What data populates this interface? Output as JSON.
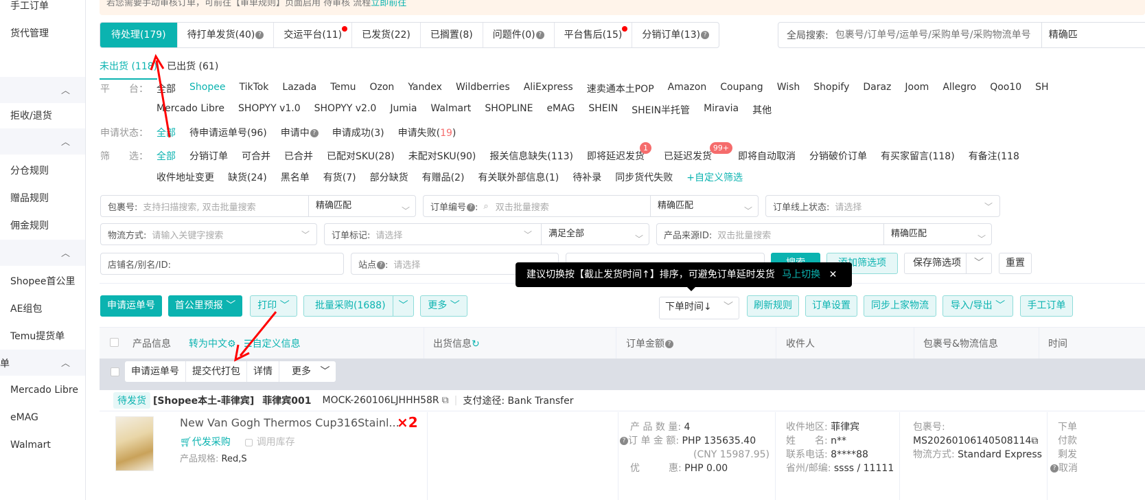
{
  "sidebar": {
    "items_top": [
      "手工订单",
      "货代管理"
    ],
    "group1_items": [
      "拒收/退货"
    ],
    "group2_items": [
      "分仓规则",
      "赠品规则",
      "佣金规则"
    ],
    "group3_items": [
      "Shopee首公里",
      "AE组包",
      "Temu提货单"
    ],
    "group4_label": "单",
    "group4_items": [
      "Mercado Libre",
      "eMAG",
      "Walmart"
    ]
  },
  "notice": {
    "text": "若您需要手动审核订单，可前往【审单规则】页面启用 待审核 流程",
    "link": "立即前往"
  },
  "tabs": [
    {
      "label": "待处理(179)"
    },
    {
      "label": "待打单发货(40)"
    },
    {
      "label": "交运平台(11)"
    },
    {
      "label": "已发货(22)"
    },
    {
      "label": "已搁置(8)"
    },
    {
      "label": "问题件(0)"
    },
    {
      "label": "平台售后(15)"
    },
    {
      "label": "分销订单(13)"
    }
  ],
  "global_search": {
    "label": "全局搜索:",
    "placeholder": "包裹号/订单号/运单号/采购单号/采购物流单号",
    "match": "精确匹"
  },
  "subtabs": [
    "未出货 (118)",
    "已出货 (61)"
  ],
  "platform": {
    "label": "平　　台：",
    "options": [
      "全部",
      "Shopee",
      "TikTok",
      "Lazada",
      "Temu",
      "Ozon",
      "Yandex",
      "Wildberries",
      "AliExpress",
      "速卖通本土POP",
      "Amazon",
      "Coupang",
      "Wish",
      "Shopify",
      "Daraz",
      "Joom",
      "Allegro",
      "Qoo10",
      "SH"
    ],
    "options2": [
      "Mercado Libre",
      "SHOPYY v1.0",
      "SHOPYY v2.0",
      "Jumia",
      "Walmart",
      "SHOPLINE",
      "eMAG",
      "SHEIN",
      "SHEIN半托管",
      "Miravia",
      "其他"
    ]
  },
  "apply_status": {
    "label": "申请状态：",
    "options": [
      "全部",
      "待申请运单号(96)",
      "申请中",
      "申请成功(3)",
      "申请失败("
    ],
    "fail_count": "19",
    "fail_close": ")"
  },
  "filter": {
    "label": "筛　　选：",
    "options": [
      "全部",
      "分销订单",
      "可合并",
      "已合并",
      "已配对SKU(28)",
      "未配对SKU(90)",
      "报关信息缺失(113)",
      "即将延迟发货",
      "已延迟发货",
      "即将自动取消",
      "分销破价订单",
      "有买家留言(118)",
      "有备注(118"
    ],
    "badge_soon": "1",
    "badge_late": "99+",
    "options2": [
      "收件地址变更",
      "缺货(24)",
      "黑名单",
      "有货(7)",
      "部分缺货",
      "有赠品(2)",
      "有关联外部信息(1)",
      "待补录",
      "同步货代失败"
    ],
    "custom": "+自定义筛选"
  },
  "form": {
    "package": {
      "label": "包裹号:",
      "placeholder": "支持扫描搜索, 双击批量搜索",
      "match": "精确匹配"
    },
    "order_no": {
      "label": "订单编号",
      "placeholder": "双击批量搜索",
      "match": "精确匹配"
    },
    "online_status": {
      "label": "订单线上状态:",
      "placeholder": "请选择"
    },
    "logistics": {
      "label": "物流方式:",
      "placeholder": "请输入关键字搜索"
    },
    "order_mark": {
      "label": "订单标记:",
      "placeholder": "请选择",
      "match": "满足全部"
    },
    "source_id": {
      "label": "产品来源ID:",
      "placeholder": "双击批量搜索",
      "match": "精确匹配"
    },
    "shop": {
      "label": "店铺名/别名/ID:"
    },
    "site": {
      "label": "站点",
      "placeholder": "请选择"
    },
    "search_btn": "搜索",
    "add_filter": "添加筛选项",
    "save_filter": "保存筛选项",
    "reset": "重置"
  },
  "tooltip": {
    "text": "建议切换按【截止发货时间↑】排序，可避免订单延时发货",
    "link": "马上切换",
    "close": "✕"
  },
  "actions": {
    "apply": "申请运单号",
    "first_mile": "首公里预报",
    "print": "打印",
    "bulk_purchase": "批量采购(1688)",
    "more": "更多",
    "sort": "下单时间↓",
    "refresh": "刷新规则",
    "settings": "订单设置",
    "sync": "同步上家物流",
    "import_export": "导入/导出",
    "manual": "手工订单"
  },
  "table": {
    "headers": {
      "product": "产品信息",
      "to_chinese": "转为中文",
      "custom_info": "自定义信息",
      "shipping": "出货信息",
      "amount": "订单金额",
      "recipient": "收件人",
      "package": "包裹号&物流信息",
      "time": "时间"
    }
  },
  "batch": [
    "申请运单号",
    "提交代打包",
    "详情",
    "更多"
  ],
  "order": {
    "status": "待发货",
    "shop": "[Shopee本土-菲律宾]",
    "shop_name": "菲律宾001",
    "order_id": "MOCK-260106LJHHH58R",
    "payment": "支付途径: Bank Transfer",
    "product_title": "New Van Gogh Thermos Cup316Stainl...",
    "qty": "×2",
    "proxy_purchase": "代发采购",
    "use_stock": "调用库存",
    "spec_label": "产品规格:",
    "spec": "Red,S",
    "amount": {
      "qty_k": "产 品 数 量:",
      "qty_v": "4",
      "total_k": "订 单 金 额:",
      "total_v": "PHP 135635.40",
      "cny": "(CNY 15987.95)",
      "disc_k": "优　　　惠:",
      "disc_v": "PHP 0.00"
    },
    "recipient": {
      "region_k": "收件地区:",
      "region_v": "菲律宾",
      "name_k": "姓　　名:",
      "name_v": "n**",
      "phone_k": "联系电话:",
      "phone_v": "8****88",
      "zip_k": "省州/邮编:",
      "zip_v": "ssss / 11111"
    },
    "package": {
      "k": "包裹号:",
      "v": "MS20260106140508114",
      "method_k": "物流方式:",
      "method_v": "Standard Express"
    },
    "time": [
      "下单",
      "付款",
      "剩发",
      "取消"
    ]
  }
}
